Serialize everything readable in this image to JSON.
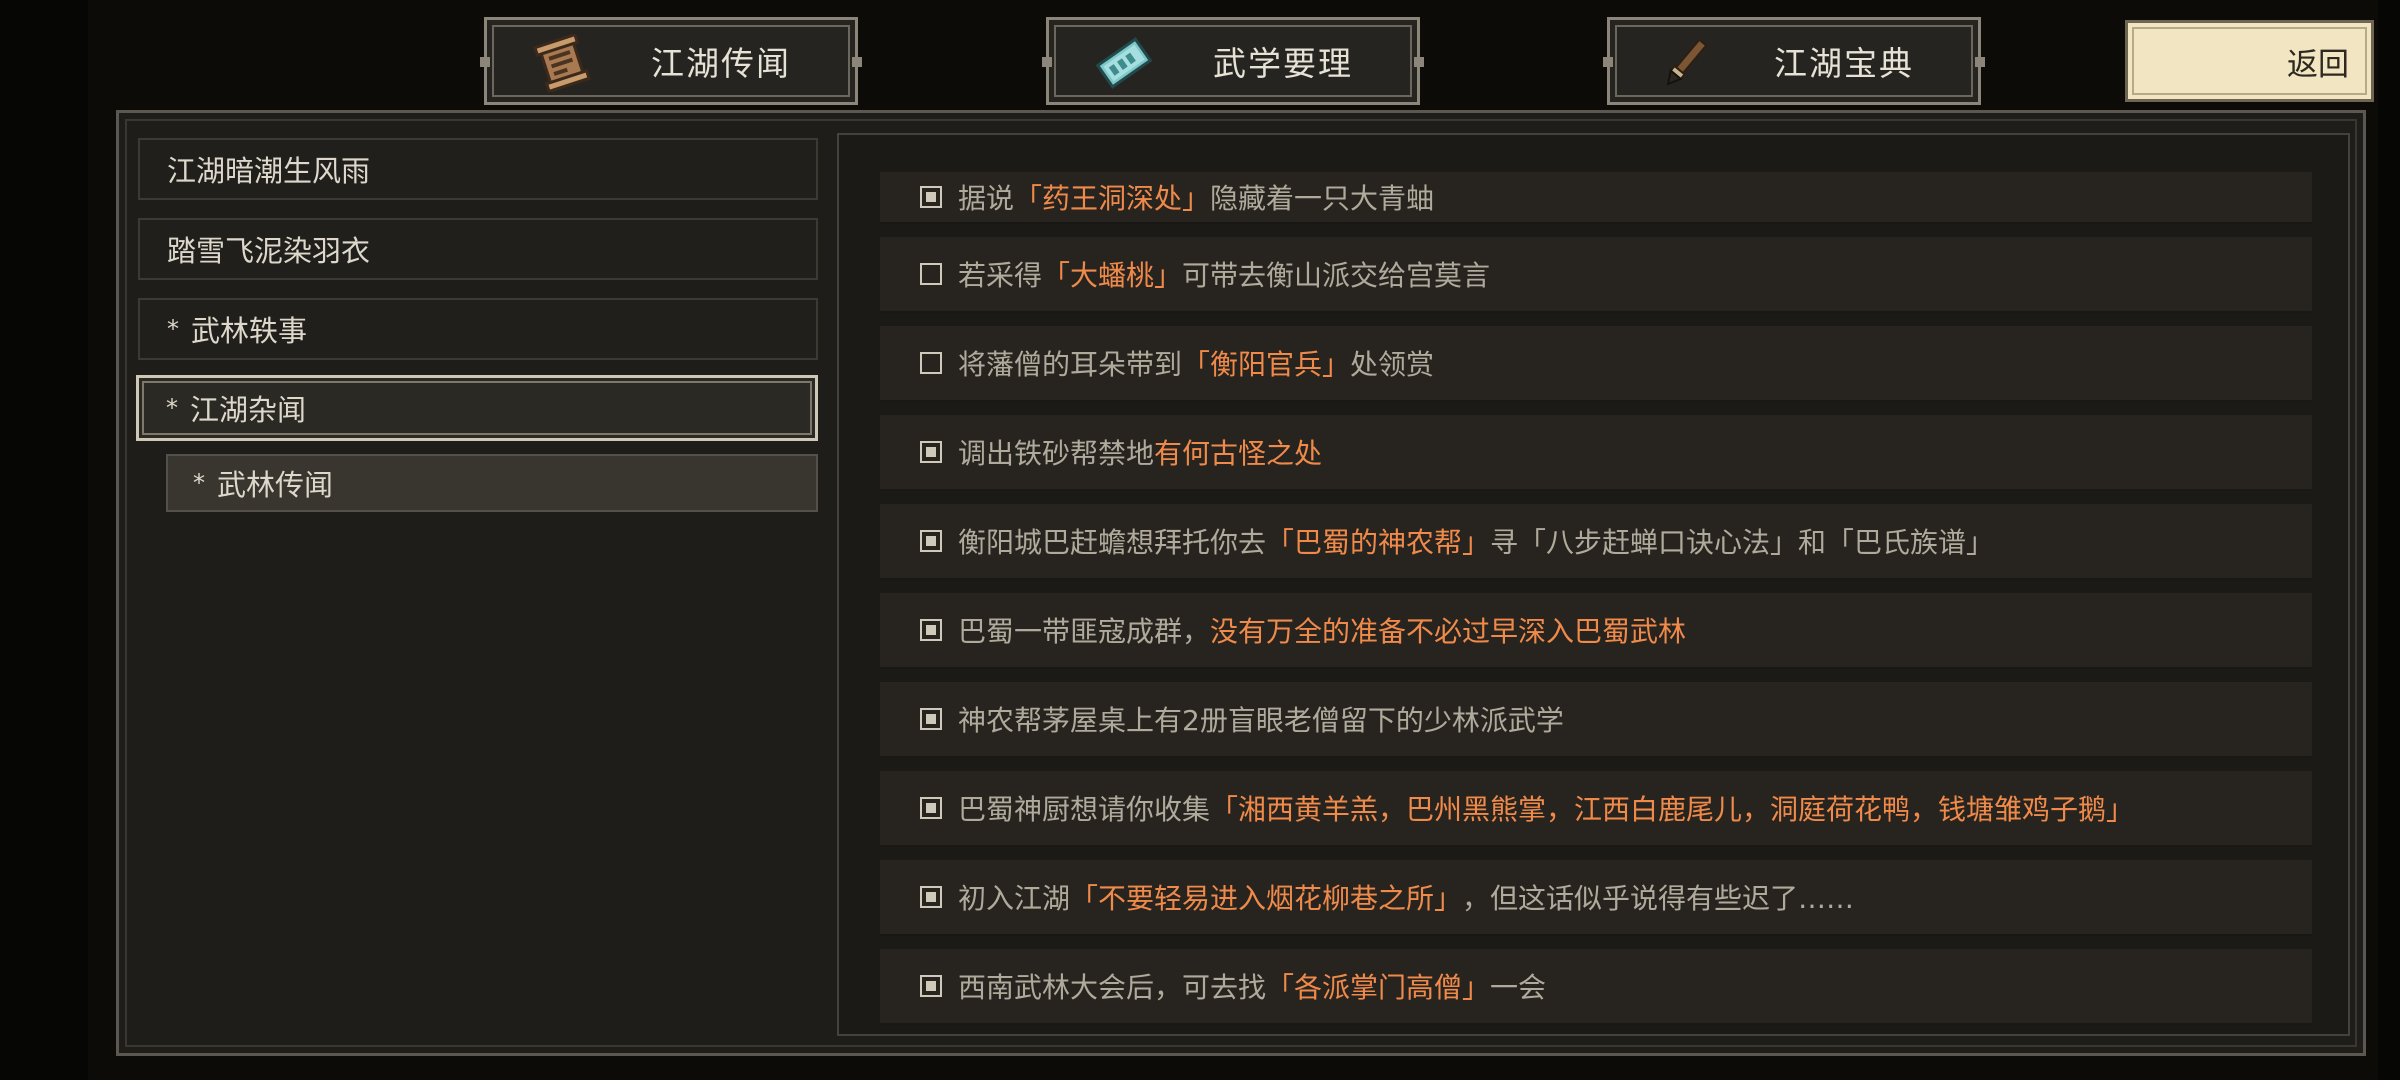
{
  "tabs": [
    {
      "label": "江湖传闻",
      "icon": "scroll-icon"
    },
    {
      "label": "武学要理",
      "icon": "martial-manual-icon"
    },
    {
      "label": "江湖宝典",
      "icon": "brush-icon"
    }
  ],
  "return_label": "返回",
  "sidebar": {
    "items": [
      {
        "label": "江湖暗潮生风雨",
        "star": ""
      },
      {
        "label": "踏雪飞泥染羽衣",
        "star": ""
      },
      {
        "label": "武林轶事",
        "star": "*"
      },
      {
        "label": "江湖杂闻",
        "star": "*",
        "active": true
      },
      {
        "label": "武林传闻",
        "star": "*",
        "sub": true
      }
    ]
  },
  "logs": [
    {
      "checked": true,
      "segments": [
        {
          "t": "据说"
        },
        {
          "t": "「药王洞深处」",
          "h": true
        },
        {
          "t": "隐藏着一只大青蚰"
        }
      ]
    },
    {
      "checked": false,
      "segments": [
        {
          "t": "若采得"
        },
        {
          "t": "「大蟠桃」",
          "h": true
        },
        {
          "t": "可带去衡山派交给宫莫言"
        }
      ]
    },
    {
      "checked": false,
      "segments": [
        {
          "t": "将藩僧的耳朵带到"
        },
        {
          "t": "「衡阳官兵」",
          "h": true
        },
        {
          "t": "处领赏"
        }
      ]
    },
    {
      "checked": true,
      "segments": [
        {
          "t": "调出铁砂帮禁地"
        },
        {
          "t": "有何古怪之处",
          "h": true
        }
      ]
    },
    {
      "checked": true,
      "segments": [
        {
          "t": "衡阳城巴赶蟾想拜托你去"
        },
        {
          "t": "「巴蜀的神农帮」",
          "h": true
        },
        {
          "t": "寻「八步赶蝉口诀心法」和「巴氏族谱」"
        }
      ]
    },
    {
      "checked": true,
      "segments": [
        {
          "t": "巴蜀一带匪寇成群，"
        },
        {
          "t": "没有万全的准备不必过早深入巴蜀武林",
          "h": true
        }
      ]
    },
    {
      "checked": true,
      "segments": [
        {
          "t": "神农帮茅屋桌上有2册盲眼老僧留下的少林派武学"
        }
      ]
    },
    {
      "checked": true,
      "segments": [
        {
          "t": "巴蜀神厨想请你收集"
        },
        {
          "t": "「湘西黄羊羔，巴州黑熊掌，江西白鹿尾儿，洞庭荷花鸭，钱塘雏鸡子鹅」",
          "h": true
        }
      ]
    },
    {
      "checked": true,
      "segments": [
        {
          "t": "初入江湖"
        },
        {
          "t": "「不要轻易进入烟花柳巷之所」",
          "h": true
        },
        {
          "t": "，但这话似乎说得有些迟了……"
        }
      ]
    },
    {
      "checked": true,
      "segments": [
        {
          "t": "西南武林大会后，可去找"
        },
        {
          "t": "「各派掌门高僧」",
          "h": true
        },
        {
          "t": "一会"
        }
      ]
    }
  ],
  "colors": {
    "background": "#0c0b08",
    "panel": "#1f1d19",
    "highlight_text": "#ef8a4a",
    "normal_text": "#b0aa9c",
    "return_button": "#f1e5c2"
  }
}
